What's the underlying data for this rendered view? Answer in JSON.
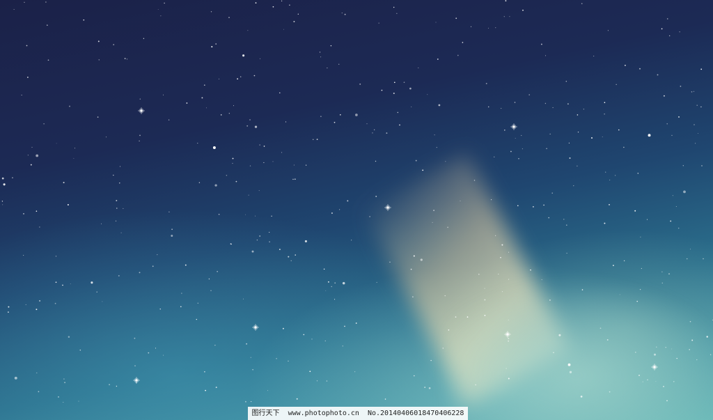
{
  "image": {
    "description_colors": {
      "sky_top": "#1b2148",
      "sky_mid": "#1f4670",
      "sky_bottom": "#6bb9b8",
      "nebula_glow": "#e6cd9a"
    }
  },
  "watermark": {
    "site_name": "图行天下",
    "url": "www.photophoto.cn",
    "number": "No.20140406018470406228"
  }
}
